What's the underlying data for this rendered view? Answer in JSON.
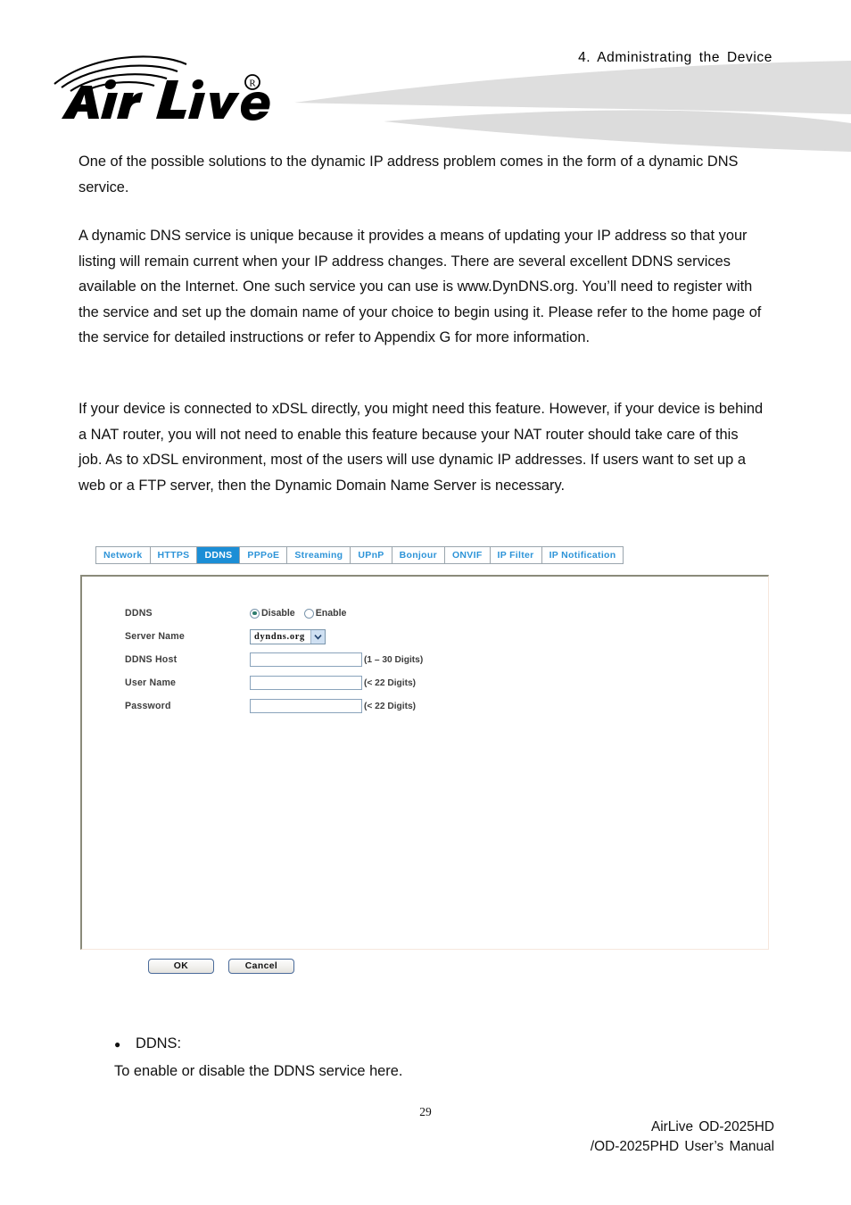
{
  "header": {
    "chapter": "4.  Administrating  the  Device",
    "logo_text": "Air Live",
    "logo_trademark": "®"
  },
  "paragraphs": {
    "p1": "One of the possible solutions to the dynamic IP address problem comes in the form of a dynamic DNS service.",
    "p2": "A dynamic DNS service is unique because it provides a means of updating your IP address so that your listing will remain current when your IP address changes. There are several excellent DDNS services available on the Internet. One such service you can use is www.DynDNS.org. You’ll need to register with the service and set up the domain name of your choice to begin using it. Please refer to the home page of the service for detailed instructions or refer to Appendix G for more information.",
    "p3": "If your device is connected to xDSL directly, you might need this feature. However, if your device is behind a NAT router, you will not need to enable this feature because your NAT router should take care of this job. As to xDSL environment, most of the users will use dynamic IP addresses. If users want to set up a web or a FTP server, then the Dynamic Domain Name Server is necessary."
  },
  "device_ui": {
    "tabs": [
      {
        "label": "Network",
        "active": false
      },
      {
        "label": "HTTPS",
        "active": false
      },
      {
        "label": "DDNS",
        "active": true
      },
      {
        "label": "PPPoE",
        "active": false
      },
      {
        "label": "Streaming",
        "active": false
      },
      {
        "label": "UPnP",
        "active": false
      },
      {
        "label": "Bonjour",
        "active": false
      },
      {
        "label": "ONVIF",
        "active": false
      },
      {
        "label": "IP Filter",
        "active": false
      },
      {
        "label": "IP Notification",
        "active": false
      }
    ],
    "active_tab_bg": "#1b8ed6",
    "tab_text_color": "#2e94d8",
    "form": {
      "ddns": {
        "label": "DDNS",
        "options": [
          {
            "label": "Disable",
            "selected": true
          },
          {
            "label": "Enable",
            "selected": false
          }
        ]
      },
      "server_name": {
        "label": "Server Name",
        "value": "dyndns.org",
        "options": [
          "dyndns.org"
        ]
      },
      "ddns_host": {
        "label": "DDNS Host",
        "value": "",
        "hint": "(1 – 30 Digits)"
      },
      "user_name": {
        "label": "User Name",
        "value": "",
        "hint": "(< 22 Digits)"
      },
      "password": {
        "label": "Password",
        "value": "",
        "hint": "(< 22 Digits)"
      }
    },
    "buttons": {
      "ok": "OK",
      "cancel": "Cancel"
    }
  },
  "notes": {
    "bullet_marker": "●",
    "bullet_title": "DDNS:",
    "bullet_body": "To enable or disable the DDNS service here."
  },
  "footer": {
    "page_number": "29",
    "manual_line1": "AirLive OD-2025HD",
    "manual_line2": "/OD-2025PHD  User’s  Manual"
  }
}
